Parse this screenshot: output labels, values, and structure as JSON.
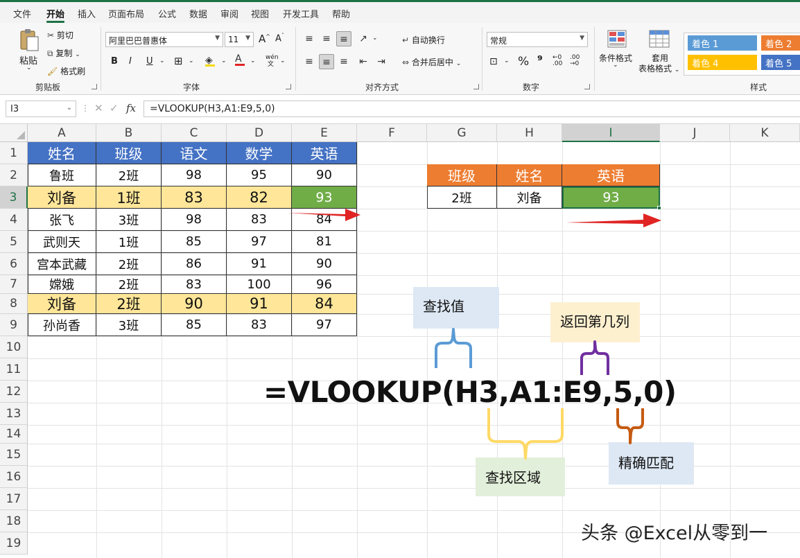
{
  "menu": [
    "文件",
    "开始",
    "插入",
    "页面布局",
    "公式",
    "数据",
    "审阅",
    "视图",
    "开发工具",
    "帮助"
  ],
  "ribbon": {
    "clipboard": {
      "paste": "粘贴",
      "cut": "剪切",
      "copy": "复制",
      "format_painter": "格式刷",
      "label": "剪贴板"
    },
    "font": {
      "name": "阿里巴巴普惠体",
      "size": "11",
      "bold": "B",
      "italic": "I",
      "underline": "U",
      "phonetic": "wén",
      "label": "字体"
    },
    "align": {
      "wrap": "自动换行",
      "merge": "合并后居中",
      "label": "对齐方式"
    },
    "number": {
      "format": "常规",
      "percent": "%",
      "label": "数字"
    },
    "styles": {
      "conditional": "条件格式",
      "table_line1": "套用",
      "table_line2": "表格格式",
      "chips": [
        "着色 1",
        "着色 2",
        "着色 4",
        "着色 5"
      ],
      "label": "样式"
    }
  },
  "formula_bar": {
    "name_box": "I3",
    "fx": "fx",
    "formula": "=VLOOKUP(H3,A1:E9,5,0)"
  },
  "columns": [
    "A",
    "B",
    "C",
    "D",
    "E",
    "F",
    "G",
    "H",
    "I",
    "J",
    "K"
  ],
  "rows": [
    "1",
    "2",
    "3",
    "4",
    "5",
    "6",
    "7",
    "8",
    "9",
    "10",
    "11",
    "12",
    "13",
    "14",
    "15",
    "16",
    "17",
    "18",
    "19"
  ],
  "table": {
    "header": [
      "姓名",
      "班级",
      "语文",
      "数学",
      "英语"
    ],
    "rows": [
      [
        "鲁班",
        "2班",
        "98",
        "95",
        "90"
      ],
      [
        "刘备",
        "1班",
        "83",
        "82",
        "93"
      ],
      [
        "张飞",
        "3班",
        "98",
        "83",
        "84"
      ],
      [
        "武则天",
        "1班",
        "85",
        "97",
        "81"
      ],
      [
        "宫本武藏",
        "2班",
        "86",
        "91",
        "90"
      ],
      [
        "嫦娥",
        "2班",
        "83",
        "100",
        "96"
      ],
      [
        "刘备",
        "2班",
        "90",
        "91",
        "84"
      ],
      [
        "孙尚香",
        "3班",
        "85",
        "83",
        "97"
      ]
    ]
  },
  "lookup": {
    "header": [
      "班级",
      "姓名",
      "英语"
    ],
    "values": [
      "2班",
      "刘备",
      "93"
    ]
  },
  "notes": {
    "lookup_value": "查找值",
    "col_index": "返回第几列",
    "range": "查找区域",
    "exact": "精确匹配"
  },
  "big_formula": "=VLOOKUP(H3,A1:E9,5,0)",
  "watermark": "头条 @Excel从零到一",
  "colors": {
    "header_blue": "#4472c4",
    "highlight": "#ffe699",
    "green": "#70ad47",
    "orange": "#ed7d31",
    "arrow": "#e02424"
  }
}
